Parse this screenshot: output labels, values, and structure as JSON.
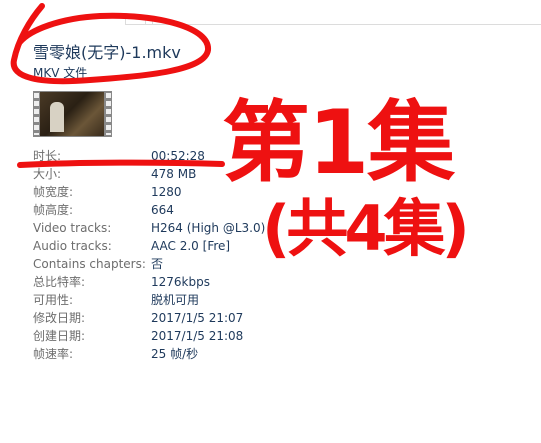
{
  "file": {
    "title": "雪零娘(无字)-1.mkv",
    "type": "MKV 文件"
  },
  "properties": [
    {
      "label": "时长:",
      "value": "00:52:28"
    },
    {
      "label": "大小:",
      "value": "478 MB"
    },
    {
      "label": "帧宽度:",
      "value": "1280"
    },
    {
      "label": "帧高度:",
      "value": "664"
    },
    {
      "label": "Video tracks:",
      "value": "H264 (High @L3.0)"
    },
    {
      "label": "Audio tracks:",
      "value": "AAC 2.0 [Fre]"
    },
    {
      "label": "Contains chapters:",
      "value": "否"
    },
    {
      "label": "总比特率:",
      "value": "1276kbps"
    },
    {
      "label": "可用性:",
      "value": "脱机可用"
    },
    {
      "label": "修改日期:",
      "value": "2017/1/5 21:07"
    },
    {
      "label": "创建日期:",
      "value": "2017/1/5 21:08"
    },
    {
      "label": "帧速率:",
      "value": "25 帧/秒"
    }
  ],
  "annotation": {
    "line1": "第1集",
    "line2": "(共4集)",
    "color": "#ee1111"
  }
}
